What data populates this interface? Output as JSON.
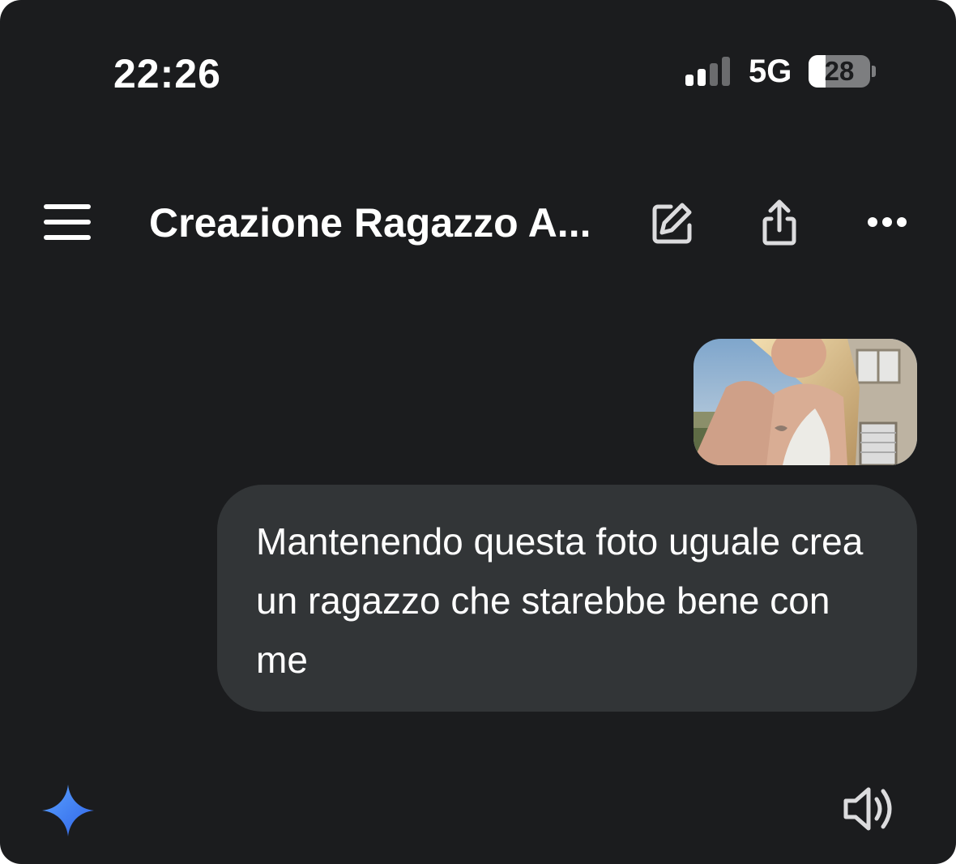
{
  "status_bar": {
    "time": "22:26",
    "network": "5G",
    "battery": "28",
    "battery_level": 0.28,
    "signal_bars_active": 2,
    "signal_bars_total": 4
  },
  "header": {
    "title": "Creazione Ragazzo A..."
  },
  "conversation": {
    "user_message": "Mantenendo questa foto uguale crea un ragazzo che starebbe bene con me"
  },
  "colors": {
    "background": "#1b1c1e",
    "bubble": "#323537",
    "text": "#ffffff",
    "gemini_blue": "#4c86f9"
  }
}
